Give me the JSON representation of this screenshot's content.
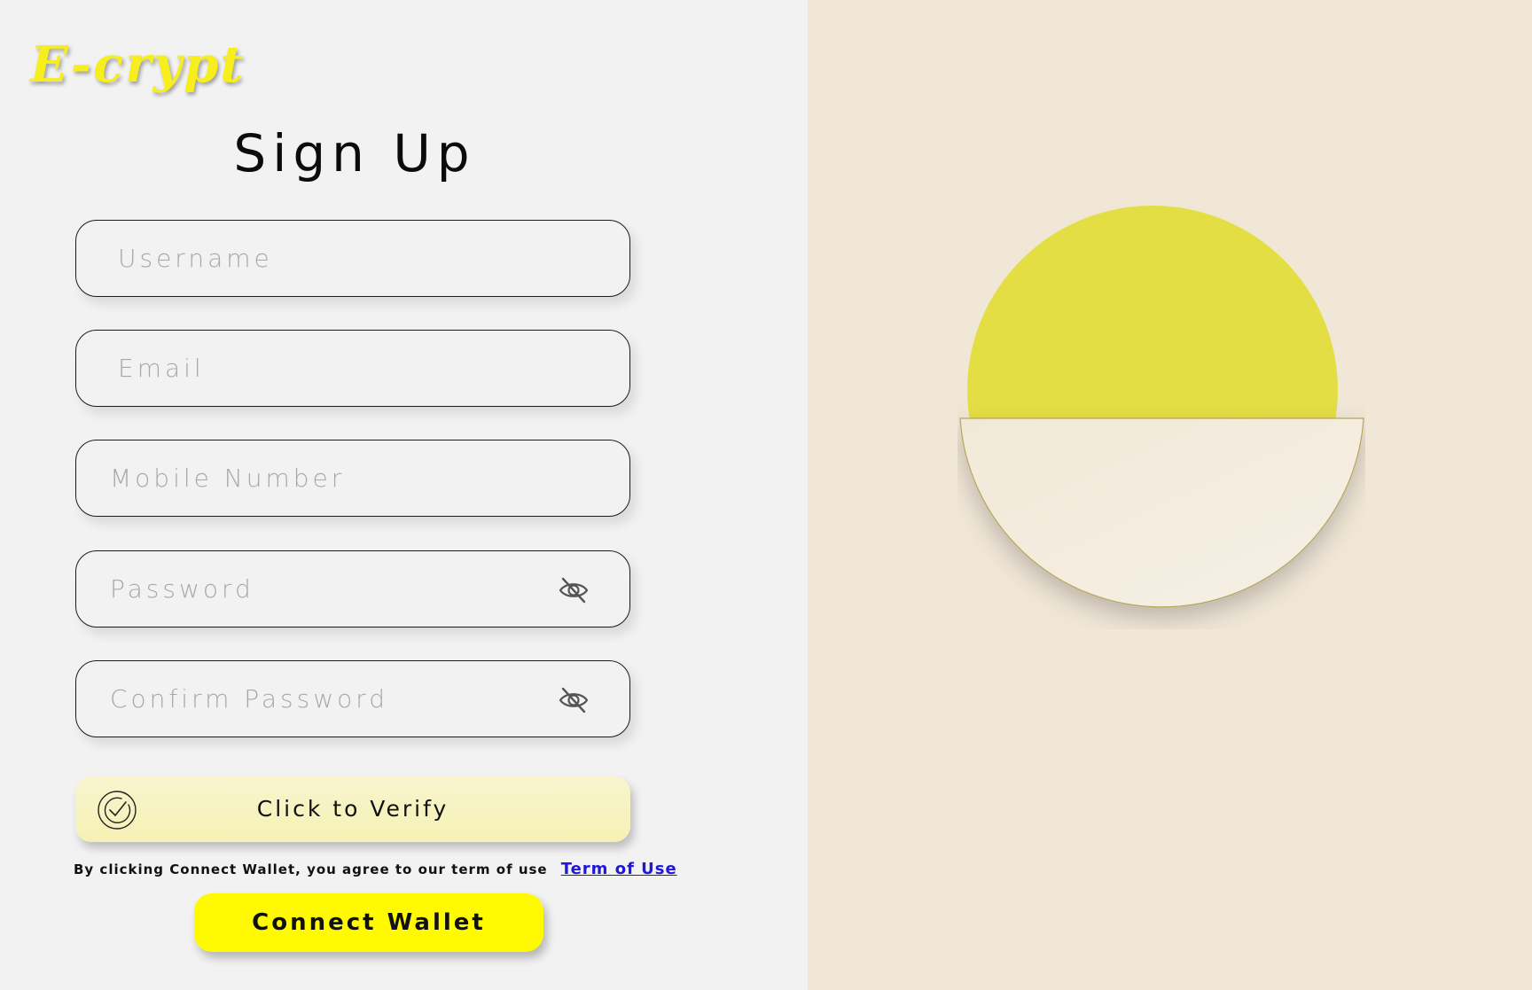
{
  "brand": {
    "logo_text": "E-crypt"
  },
  "page": {
    "title": "Sign Up"
  },
  "form": {
    "username_placeholder": "Username",
    "email_placeholder": "Email",
    "mobile_placeholder": "Mobile Number",
    "password_placeholder": "Password",
    "confirm_password_placeholder": "Confirm Password",
    "password_toggle_icon": "eye-slash-icon",
    "confirm_password_toggle_icon": "eye-slash-icon"
  },
  "verify": {
    "label": "Click to Verify",
    "icon": "verified-check-icon"
  },
  "terms": {
    "text": "By clicking Connect Wallet, you agree to our term of use",
    "link_label": "Term of Use"
  },
  "connect": {
    "label": "Connect Wallet"
  },
  "colors": {
    "left_background": "#f2f2f2",
    "right_background": "#f0e7d7",
    "logo": "#f7ee1d",
    "connect_button": "#fffa02",
    "verify_button": "#f6f2b4",
    "link": "#2018d8",
    "sun": "#e4de45",
    "bowl": "#f4ede1"
  }
}
